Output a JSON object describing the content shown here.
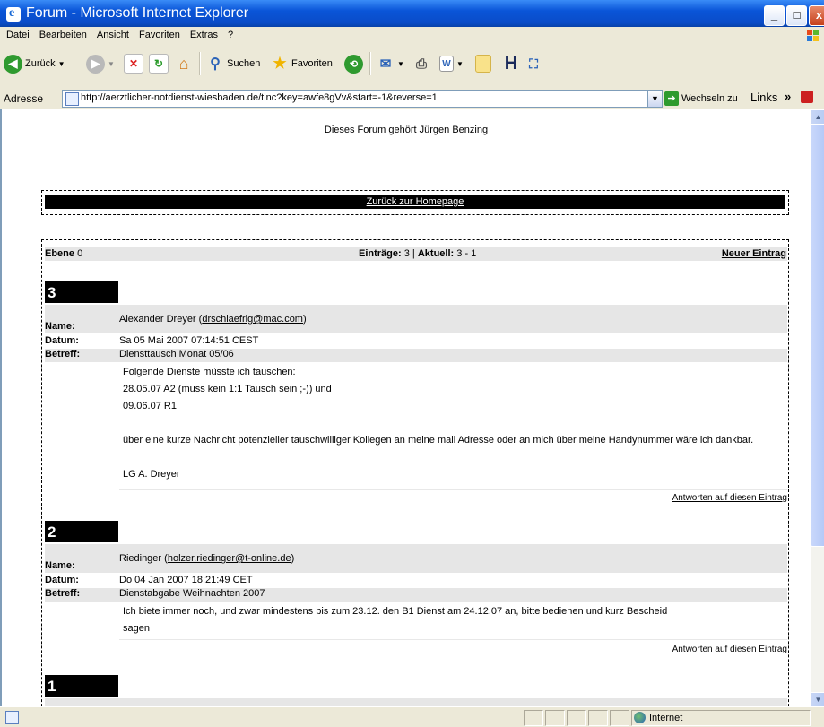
{
  "window": {
    "title": "Forum - Microsoft Internet Explorer",
    "buttons": [
      "_",
      "□",
      "x"
    ]
  },
  "menu": [
    "Datei",
    "Bearbeiten",
    "Ansicht",
    "Favoriten",
    "Extras",
    "?"
  ],
  "toolbar": {
    "back_label": "Zurück",
    "search_label": "Suchen",
    "favorites_label": "Favoriten"
  },
  "address": {
    "label": "Adresse",
    "url": "http://aerztlicher-notdienst-wiesbaden.de/tinc?key=awfe8gVv&start=-1&reverse=1",
    "go_label": "Wechseln zu",
    "links_label": "Links"
  },
  "page": {
    "owner_prefix": "Dieses Forum gehört",
    "owner_name": "Jürgen Benzing",
    "back_link": "Zurück zur Homepage",
    "level_label": "Ebene",
    "level_value": "0",
    "entries_label": "Einträge:",
    "entries_value": "3",
    "current_label": "Aktuell:",
    "current_value": "3 - 1",
    "new_entry": "Neuer Eintrag",
    "field_name": "Name:",
    "field_date": "Datum:",
    "field_subject": "Betreff:",
    "reply_label": "Antworten auf diesen Eintrag"
  },
  "entries": [
    {
      "number": "3",
      "name": "Alexander Dreyer",
      "email": "drschlaefrig@mac.com",
      "date": "Sa 05 Mai 2007 07:14:51 CEST",
      "subject": "Diensttausch Monat 05/06",
      "lines": [
        "Folgende Dienste müsste ich tauschen:",
        "28.05.07 A2 (muss kein 1:1 Tausch sein ;-)) und",
        "09.06.07 R1",
        "",
        "über eine kurze Nachricht potenzieller tauschwilliger Kollegen an meine mail Adresse oder an mich über meine Handynummer wäre ich dankbar.",
        "",
        "LG A. Dreyer"
      ]
    },
    {
      "number": "2",
      "name": "Riedinger",
      "email": "holzer.riedinger@t-online.de",
      "date": "Do 04 Jan 2007 18:21:49 CET",
      "subject": "Dienstabgabe Weihnachten 2007",
      "lines": [
        "Ich biete immer noch, und zwar mindestens bis zum 23.12. den B1 Dienst am 24.12.07 an, bitte bedienen und kurz Bescheid",
        "sagen"
      ]
    },
    {
      "number": "1"
    }
  ],
  "status": {
    "zone": "Internet"
  }
}
